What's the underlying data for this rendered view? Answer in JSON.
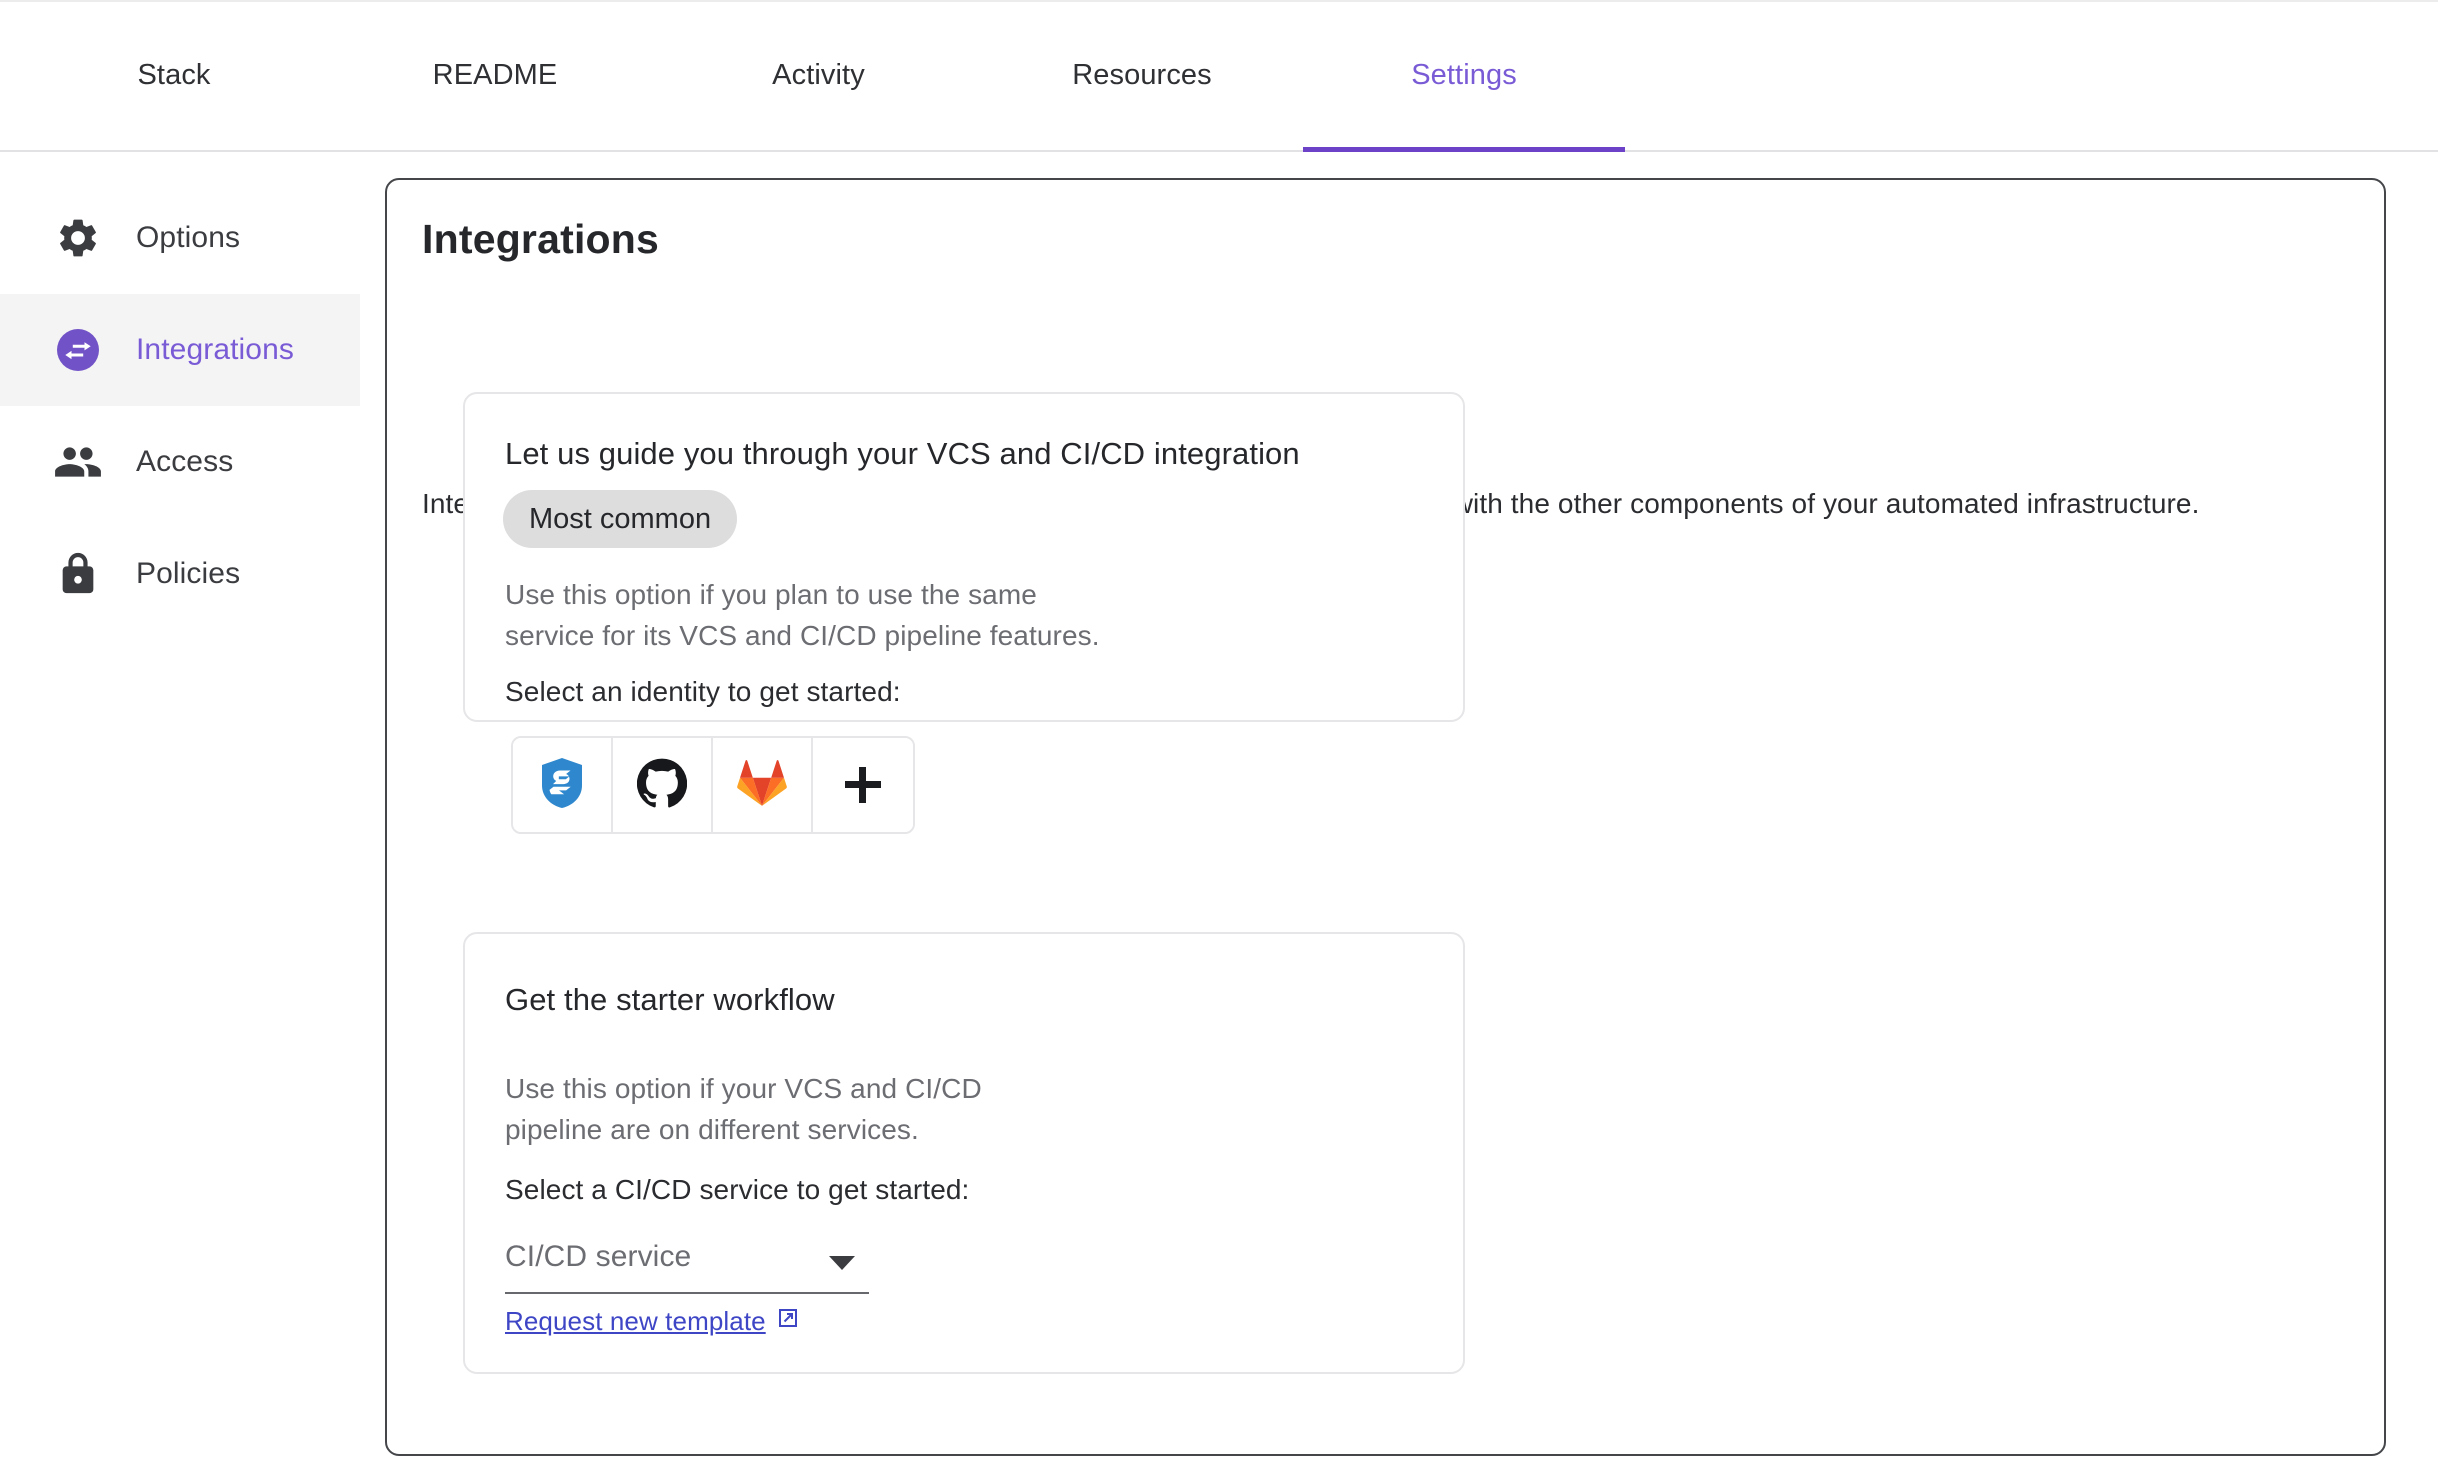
{
  "tabs": [
    {
      "label": "Stack",
      "active": false
    },
    {
      "label": "README",
      "active": false
    },
    {
      "label": "Activity",
      "active": false
    },
    {
      "label": "Resources",
      "active": false
    },
    {
      "label": "Settings",
      "active": true
    }
  ],
  "sidebar": {
    "items": [
      {
        "label": "Options",
        "icon": "gear-icon",
        "active": false
      },
      {
        "label": "Integrations",
        "icon": "integrations-icon",
        "active": true
      },
      {
        "label": "Access",
        "icon": "people-icon",
        "active": false
      },
      {
        "label": "Policies",
        "icon": "lock-icon",
        "active": false
      }
    ]
  },
  "main": {
    "title": "Integrations",
    "description": "Integrations help you to ship software faster and more safely by combining Pulumi with the other components of your automated infrastructure.",
    "cards": [
      {
        "title": "Let us guide you through your VCS and CI/CD integration",
        "badge": "Most common",
        "body": "Use this option if you plan to use the same service for its VCS and CI/CD pipeline features.",
        "prompt": "Select an identity to get started:",
        "identities": [
          {
            "name": "bitbucket-shield-icon",
            "label": "Bitbucket"
          },
          {
            "name": "github-icon",
            "label": "GitHub"
          },
          {
            "name": "gitlab-icon",
            "label": "GitLab"
          },
          {
            "name": "add-identity-icon",
            "label": "+"
          }
        ]
      },
      {
        "title": "Get the starter workflow",
        "body": "Use this option if your VCS and CI/CD pipeline are on different services.",
        "prompt": "Select a CI/CD service to get started:",
        "select": {
          "value": "CI/CD service"
        },
        "link": {
          "label": "Request new template",
          "icon": "external-link-icon"
        }
      }
    ]
  },
  "colors": {
    "accent": "#7a5bd6",
    "accent_underline": "#6b42c8",
    "link": "#3e46c6",
    "badge_bg": "#dddddd",
    "panel_border": "#44464a",
    "card_border": "#e6e6e8",
    "muted_text": "#6c6d72",
    "gitlab_orange": "#e24329",
    "bitbucket_blue": "#2f88cd"
  }
}
